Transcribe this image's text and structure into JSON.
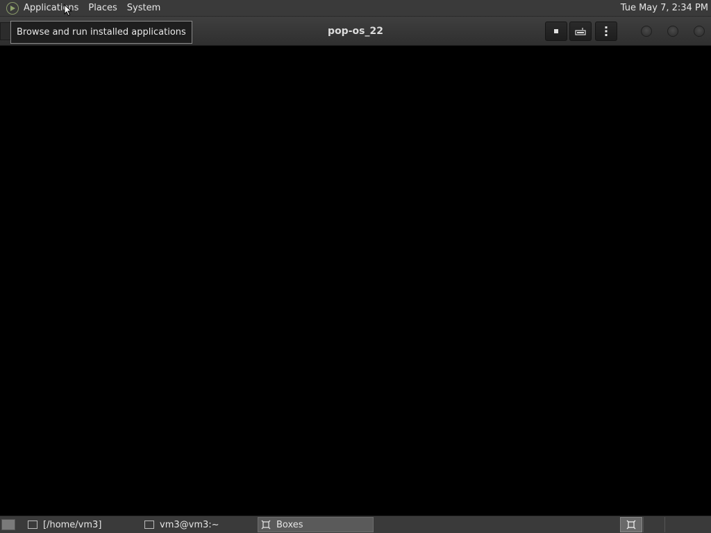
{
  "top_panel": {
    "menus": [
      "Applications",
      "Places",
      "System"
    ],
    "clock": "Tue May 7, 2:34 PM"
  },
  "tooltip": "Browse and run installed applications",
  "titlebar": {
    "title": "pop-os_22",
    "buttons": [
      "stop-icon",
      "keyboard-icon",
      "more-vertical-icon"
    ],
    "window_controls": [
      "minimize-button",
      "maximize-button",
      "close-button"
    ]
  },
  "taskbar": {
    "tasks": [
      {
        "label": "[/home/vm3]",
        "icon": "folder-window-icon",
        "active": false
      },
      {
        "label": "vm3@vm3:~",
        "icon": "terminal-icon",
        "active": false
      },
      {
        "label": "Boxes",
        "icon": "boxes-icon",
        "active": true
      }
    ]
  }
}
